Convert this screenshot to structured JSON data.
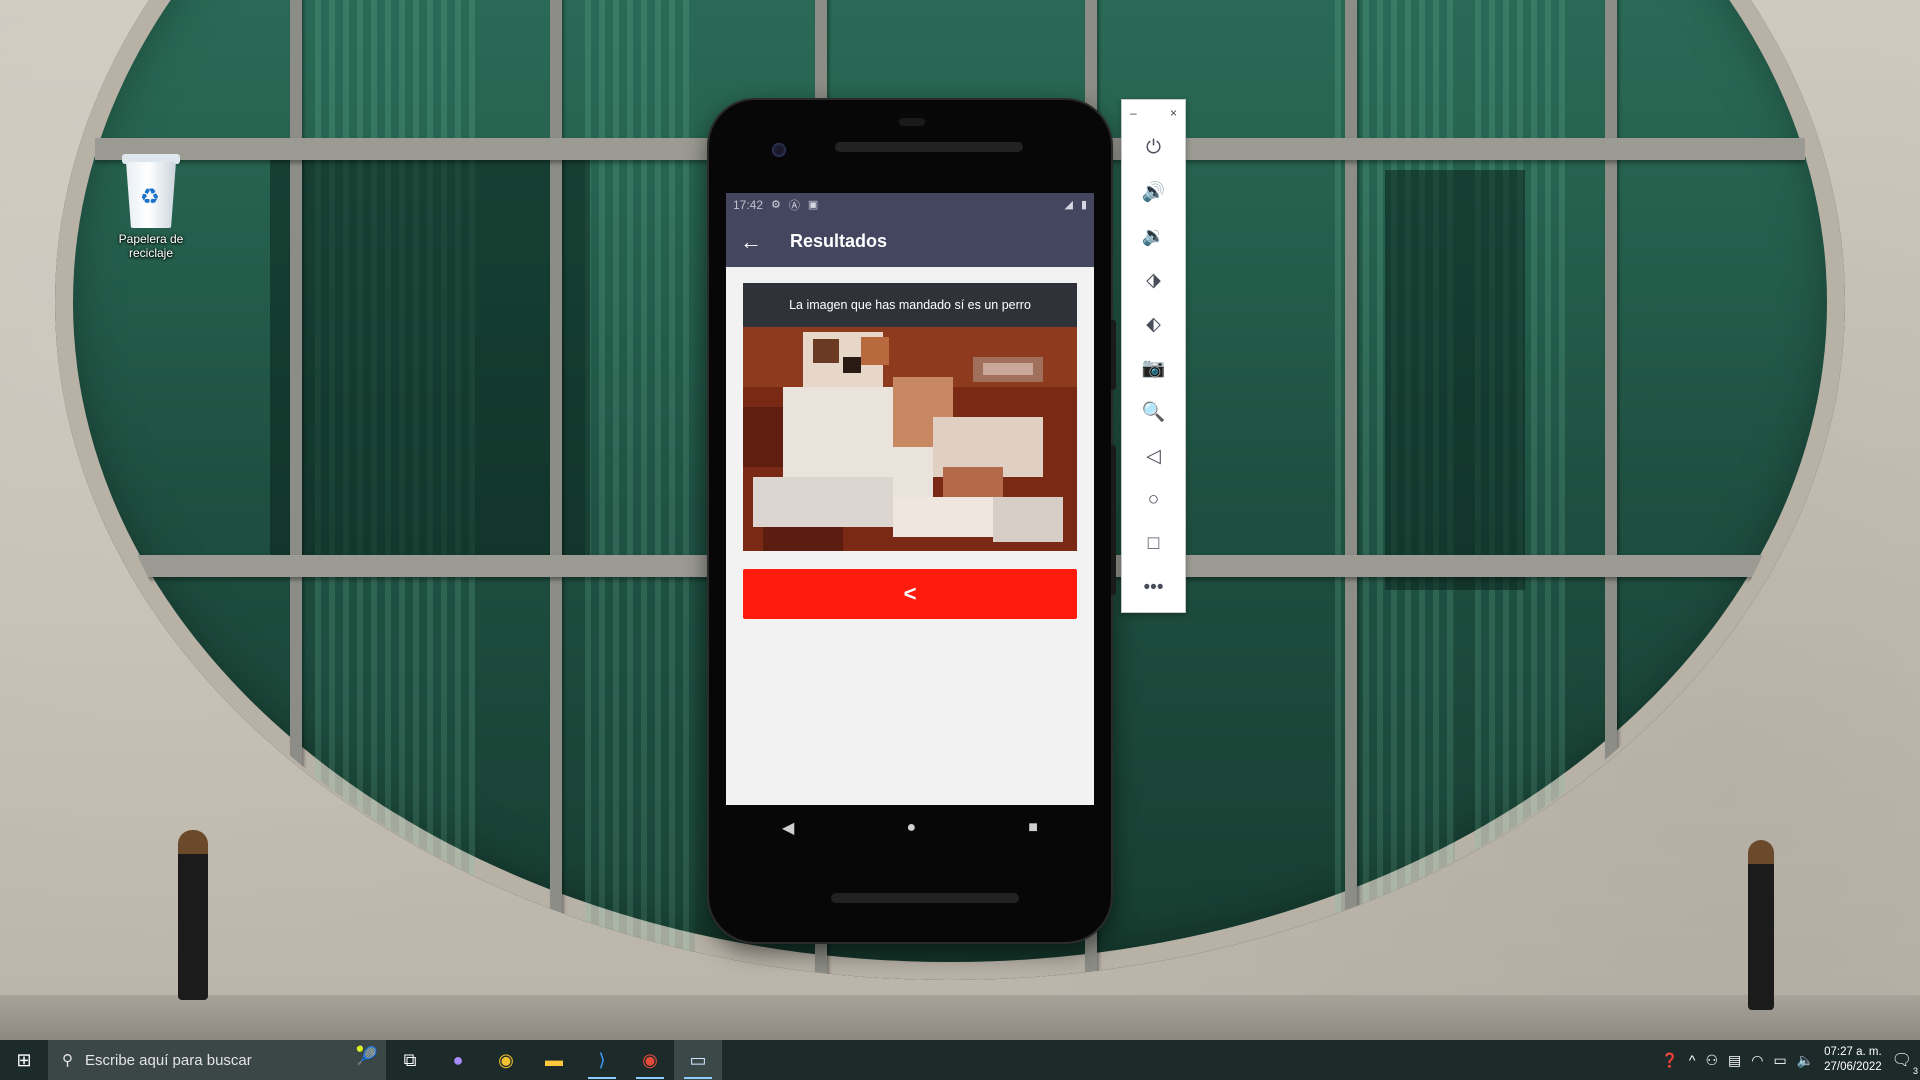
{
  "desktop": {
    "recycle_bin_label": "Papelera de reciclaje"
  },
  "phone": {
    "status": {
      "time": "17:42"
    },
    "appbar": {
      "back_icon": "arrow-back-icon",
      "title": "Resultados"
    },
    "result": {
      "caption": "La imagen que has mandado sí es un perro",
      "image_subject": "dog photo (pixelated)"
    },
    "back_button": {
      "label": "<",
      "color": "#ff1c0d"
    },
    "nav": {
      "back": "◀",
      "home": "●",
      "recents": "■"
    }
  },
  "emulator_toolbar": {
    "minimize": "–",
    "close": "×",
    "buttons": [
      "power-icon",
      "volume-up-icon",
      "volume-down-icon",
      "rotate-left-icon",
      "rotate-right-icon",
      "camera-icon",
      "zoom-icon",
      "back-icon",
      "home-icon",
      "overview-icon",
      "more-icon"
    ]
  },
  "taskbar": {
    "search_placeholder": "Escribe aquí para buscar",
    "clock_time": "07:27 a. m.",
    "clock_date": "27/06/2022",
    "notification_count": "3"
  },
  "colors": {
    "appbar": "#44455e",
    "accent_button": "#ff1c0d",
    "taskbar": "#1d2a2a"
  }
}
